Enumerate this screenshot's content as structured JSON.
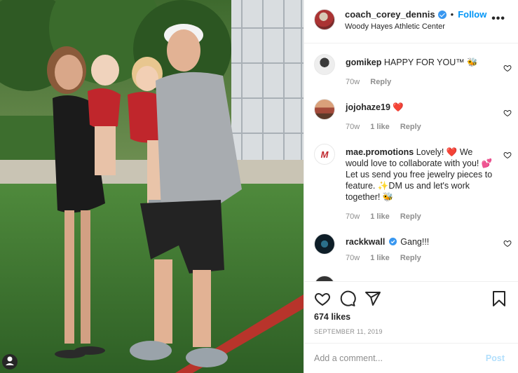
{
  "post": {
    "username": "coach_corey_dennis",
    "separator": "•",
    "follow_label": "Follow",
    "location": "Woody Hayes Athletic Center",
    "more_label": "•••",
    "likes": "674 likes",
    "date": "SEPTEMBER 11, 2019",
    "add_comment_placeholder": "Add a comment...",
    "post_label": "Post"
  },
  "comments": [
    {
      "user": "gomikep",
      "text": "HAPPY FOR YOU™ 🐝",
      "age": "70w",
      "likes": "",
      "reply": "Reply",
      "verified": false
    },
    {
      "user": "jojohaze19",
      "text": "❤️",
      "age": "70w",
      "likes": "1 like",
      "reply": "Reply",
      "verified": false
    },
    {
      "user": "mae.promotions",
      "text": "Lovely! ❤️ We would love to collaborate with you! 💕Let us send you free jewelry pieces to feature. ✨DM us and let's work together! 🐝",
      "age": "70w",
      "likes": "1 like",
      "reply": "Reply",
      "verified": false
    },
    {
      "user": "rackkwall",
      "text": "Gang!!!",
      "age": "70w",
      "likes": "1 like",
      "reply": "Reply",
      "verified": true
    }
  ],
  "colors": {
    "accent": "#0095f6",
    "verified": "#3897f0",
    "muted": "#8e8e8e",
    "heart": "#e0363e"
  },
  "icons": [
    "verified-badge-icon",
    "more-options-icon",
    "heart-icon",
    "comment-icon",
    "share-icon",
    "bookmark-icon"
  ]
}
